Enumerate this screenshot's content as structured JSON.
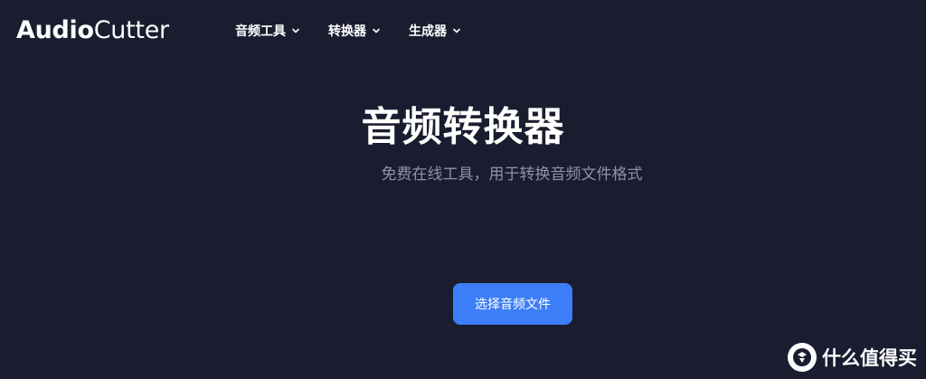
{
  "header": {
    "logo": {
      "bold_part": "Audio",
      "light_part": "Cutter"
    },
    "nav": [
      {
        "label": "音频工具",
        "icon": "chevron-down-icon"
      },
      {
        "label": "转换器",
        "icon": "chevron-down-icon"
      },
      {
        "label": "生成器",
        "icon": "chevron-down-icon"
      }
    ]
  },
  "hero": {
    "title": "音频转换器",
    "subtitle": "免费在线工具，用于转换音频文件格式",
    "cta_label": "选择音频文件"
  },
  "watermark": {
    "text": "什么值得买",
    "icon": "smzdm-logo-icon"
  },
  "colors": {
    "background": "#1a1d30",
    "primary_button": "#3c7ef7",
    "subtitle": "#8e93a6",
    "text": "#ffffff"
  }
}
